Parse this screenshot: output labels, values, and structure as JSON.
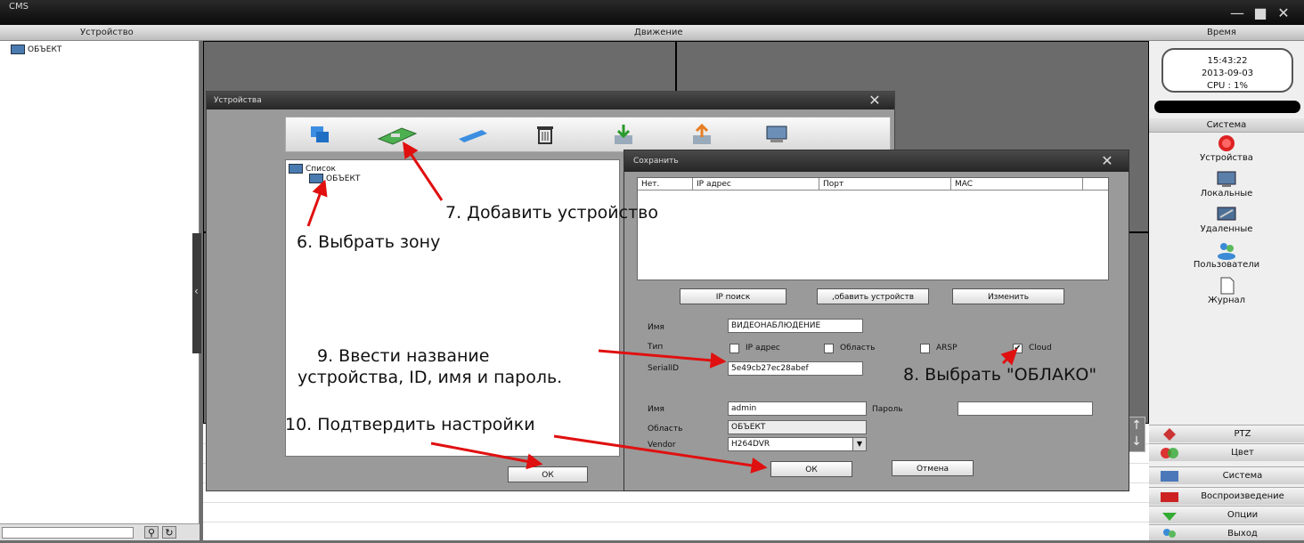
{
  "app": {
    "title": "CMS"
  },
  "header": {
    "device": "Устройство",
    "motion": "Движение",
    "time": "Время"
  },
  "left_tree": {
    "root": "ОБЪЕКТ"
  },
  "clock": {
    "time": "15:43:22",
    "date": "2013-09-03",
    "cpu": "CPU : 1%"
  },
  "system_panel": {
    "title": "Система",
    "items": [
      {
        "label": "Устройства",
        "icon": "red-circle-icon"
      },
      {
        "label": "Локальные",
        "icon": "local-config-icon"
      },
      {
        "label": "Удаленные",
        "icon": "remote-config-icon"
      },
      {
        "label": "Пользователи",
        "icon": "users-icon"
      },
      {
        "label": "Журнал",
        "icon": "log-icon"
      }
    ]
  },
  "right_buttons": [
    {
      "label": "PTZ",
      "icon": "ptz-icon"
    },
    {
      "label": "Цвет",
      "icon": "color-icon"
    },
    {
      "label": "Система",
      "icon": "system-icon"
    },
    {
      "label": "Воспроизведение",
      "icon": "playback-icon"
    },
    {
      "label": "Опции",
      "icon": "options-icon"
    },
    {
      "label": "Выход",
      "icon": "exit-icon"
    }
  ],
  "devices_dialog": {
    "title": "Устройства",
    "tree": {
      "root": "Список",
      "child": "ОБЪЕКТ"
    },
    "ok": "ОК"
  },
  "save_dialog": {
    "title": "Сохранить",
    "columns": [
      "Нет.",
      "IP адрес",
      "Порт",
      "MAC"
    ],
    "buttons": {
      "ip_search": "IP поиск",
      "add_device": ",обавить устройств",
      "edit": "Изменить"
    },
    "name_label": "Имя",
    "name_value": "ВИДЕОНАБЛЮДЕНИЕ",
    "type_label": "Тип",
    "types": [
      {
        "label": "IP адрес",
        "checked": false
      },
      {
        "label": "Область",
        "checked": false
      },
      {
        "label": "ARSP",
        "checked": false
      },
      {
        "label": "Cloud",
        "checked": true
      }
    ],
    "serial_label": "SerialID",
    "serial_value": "5e49cb27ec28abef",
    "user_label": "Имя",
    "user_value": "admin",
    "password_label": "Пароль",
    "password_value": "",
    "area_label": "Область",
    "area_value": "ОБЪЕКТ",
    "vendor_label": "Vendor",
    "vendor_value": "H264DVR",
    "ok": "ОК",
    "cancel": "Отмена"
  },
  "annotations": {
    "step6": "6. Выбрать зону",
    "step7": "7. Добавить устройство",
    "step8": "8. Выбрать \"ОБЛАКО\"",
    "step9_line1": "9. Ввести название",
    "step9_line2": "устройства, ID, имя и пароль.",
    "step10": "10. Подтвердить настройки"
  }
}
